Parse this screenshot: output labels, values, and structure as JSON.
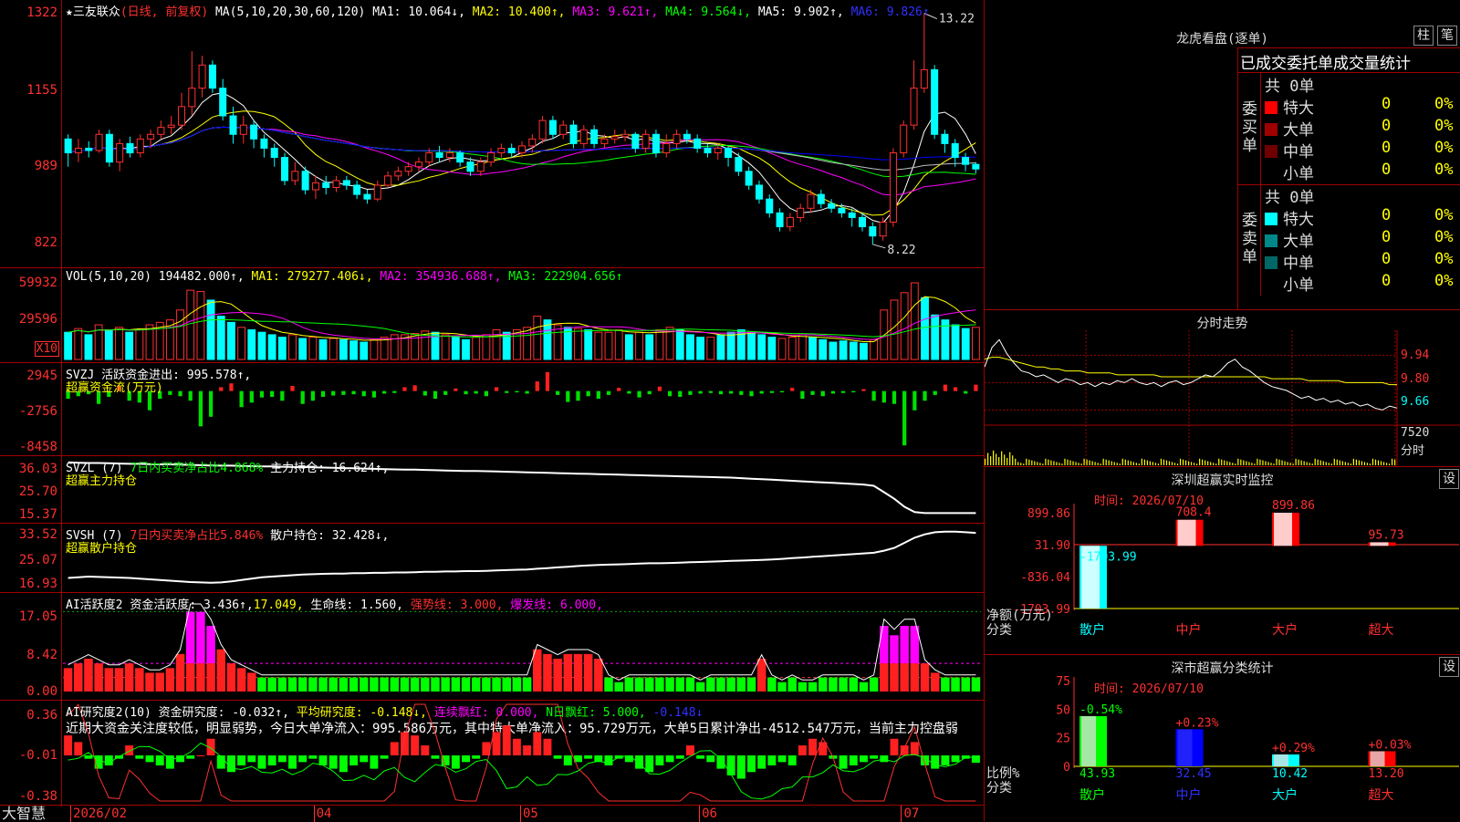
{
  "kline": {
    "ticks": [
      "1322",
      "1155",
      "989",
      "822"
    ],
    "legend": {
      "star": "★",
      "name": "三友联众",
      "mode": "(日线, 前复权)",
      "ma_def": "MA(5,10,20,30,60,120)",
      "ma1": "MA1: 10.064↓,",
      "ma2": "MA2: 10.400↑,",
      "ma3": "MA3: 9.621↑,",
      "ma4": "MA4: 9.564↓,",
      "ma5": "MA5: 9.902↑,",
      "ma6": "MA6: 9.826↑"
    },
    "hi_label": "13.22",
    "lo_label": "8.22",
    "candles": [
      [
        10.5,
        10.2,
        10.6,
        9.9
      ],
      [
        10.2,
        10.3,
        10.5,
        10.0
      ],
      [
        10.3,
        10.25,
        10.45,
        10.1
      ],
      [
        10.25,
        10.6,
        10.7,
        10.2
      ],
      [
        10.6,
        10.0,
        10.7,
        9.9
      ],
      [
        10.0,
        10.4,
        10.5,
        9.8
      ],
      [
        10.4,
        10.2,
        10.55,
        10.1
      ],
      [
        10.2,
        10.5,
        10.6,
        10.1
      ],
      [
        10.5,
        10.6,
        10.7,
        10.3
      ],
      [
        10.6,
        10.75,
        10.9,
        10.5
      ],
      [
        10.75,
        10.8,
        11.0,
        10.6
      ],
      [
        10.8,
        11.2,
        11.5,
        10.7
      ],
      [
        11.2,
        11.6,
        12.4,
        11.0
      ],
      [
        11.6,
        12.1,
        12.3,
        11.4
      ],
      [
        12.1,
        11.6,
        12.2,
        11.5
      ],
      [
        11.6,
        11.0,
        11.8,
        10.9
      ],
      [
        11.0,
        10.6,
        11.2,
        10.4
      ],
      [
        10.6,
        10.8,
        11.0,
        10.4
      ],
      [
        10.8,
        10.5,
        10.9,
        10.3
      ],
      [
        10.5,
        10.3,
        10.6,
        10.1
      ],
      [
        10.3,
        10.1,
        10.4,
        9.9
      ],
      [
        10.1,
        9.6,
        10.2,
        9.5
      ],
      [
        9.6,
        9.8,
        10.0,
        9.5
      ],
      [
        9.8,
        9.4,
        9.9,
        9.3
      ],
      [
        9.4,
        9.55,
        9.7,
        9.2
      ],
      [
        9.55,
        9.45,
        9.7,
        9.3
      ],
      [
        9.45,
        9.6,
        9.7,
        9.35
      ],
      [
        9.6,
        9.5,
        9.7,
        9.4
      ],
      [
        9.5,
        9.3,
        9.6,
        9.2
      ],
      [
        9.3,
        9.2,
        9.4,
        9.1
      ],
      [
        9.2,
        9.5,
        9.6,
        9.15
      ],
      [
        9.5,
        9.7,
        9.8,
        9.45
      ],
      [
        9.7,
        9.8,
        9.9,
        9.6
      ],
      [
        9.8,
        9.9,
        10.0,
        9.7
      ],
      [
        9.9,
        10.0,
        10.1,
        9.8
      ],
      [
        10.0,
        10.2,
        10.3,
        9.9
      ],
      [
        10.2,
        10.1,
        10.35,
        10.0
      ],
      [
        10.1,
        10.2,
        10.3,
        10.0
      ],
      [
        10.2,
        10.0,
        10.25,
        9.9
      ],
      [
        10.0,
        9.8,
        10.1,
        9.7
      ],
      [
        9.8,
        10.0,
        10.1,
        9.7
      ],
      [
        10.0,
        10.2,
        10.3,
        9.9
      ],
      [
        10.2,
        10.3,
        10.4,
        10.1
      ],
      [
        10.3,
        10.2,
        10.4,
        10.1
      ],
      [
        10.2,
        10.35,
        10.45,
        10.1
      ],
      [
        10.35,
        10.5,
        10.6,
        10.2
      ],
      [
        10.5,
        10.9,
        11.0,
        10.4
      ],
      [
        10.9,
        10.6,
        11.0,
        10.5
      ],
      [
        10.6,
        10.8,
        10.9,
        10.5
      ],
      [
        10.8,
        10.4,
        10.9,
        10.3
      ],
      [
        10.4,
        10.7,
        10.8,
        10.3
      ],
      [
        10.7,
        10.4,
        10.8,
        10.3
      ],
      [
        10.4,
        10.5,
        10.6,
        10.3
      ],
      [
        10.5,
        10.55,
        10.7,
        10.4
      ],
      [
        10.55,
        10.6,
        10.7,
        10.45
      ],
      [
        10.6,
        10.3,
        10.65,
        10.2
      ],
      [
        10.3,
        10.6,
        10.7,
        10.2
      ],
      [
        10.6,
        10.2,
        10.7,
        10.1
      ],
      [
        10.2,
        10.4,
        10.6,
        10.1
      ],
      [
        10.4,
        10.6,
        10.7,
        10.3
      ],
      [
        10.6,
        10.5,
        10.7,
        10.4
      ],
      [
        10.5,
        10.3,
        10.6,
        10.2
      ],
      [
        10.3,
        10.2,
        10.4,
        10.1
      ],
      [
        10.2,
        10.3,
        10.4,
        10.05
      ],
      [
        10.3,
        10.1,
        10.35,
        9.9
      ],
      [
        10.1,
        9.8,
        10.2,
        9.7
      ],
      [
        9.8,
        9.5,
        9.9,
        9.4
      ],
      [
        9.5,
        9.2,
        9.6,
        9.1
      ],
      [
        9.2,
        8.9,
        9.3,
        8.8
      ],
      [
        8.9,
        8.6,
        9.0,
        8.5
      ],
      [
        8.6,
        8.8,
        8.9,
        8.5
      ],
      [
        8.8,
        9.0,
        9.1,
        8.7
      ],
      [
        9.0,
        9.3,
        9.4,
        8.9
      ],
      [
        9.3,
        9.1,
        9.4,
        9.0
      ],
      [
        9.1,
        9.0,
        9.2,
        8.9
      ],
      [
        9.0,
        8.9,
        9.1,
        8.8
      ],
      [
        8.9,
        8.8,
        9.0,
        8.6
      ],
      [
        8.8,
        8.6,
        8.9,
        8.5
      ],
      [
        8.6,
        8.4,
        8.7,
        8.22
      ],
      [
        8.4,
        8.7,
        8.8,
        8.3
      ],
      [
        8.7,
        10.2,
        10.3,
        8.6
      ],
      [
        10.2,
        10.8,
        10.9,
        10.1
      ],
      [
        10.8,
        11.6,
        12.2,
        10.7
      ],
      [
        11.6,
        12.0,
        13.22,
        11.5
      ],
      [
        12.0,
        10.6,
        12.1,
        10.5
      ],
      [
        10.6,
        10.4,
        10.7,
        10.2
      ],
      [
        10.4,
        10.1,
        10.5,
        9.9
      ],
      [
        10.1,
        9.95,
        10.2,
        9.8
      ],
      [
        9.95,
        9.85,
        10.0,
        9.75
      ]
    ],
    "ma_colors": [
      "#ffffff",
      "#ffff00",
      "#ff00ff",
      "#00ff00",
      "#c0c0c0",
      "#0000ff"
    ]
  },
  "vol": {
    "ticks": [
      "59932",
      "29596"
    ],
    "unit": "X10",
    "legend": {
      "def": "VOL(5,10,20)",
      "val": "194482.000↑,",
      "ma1": "MA1: 279277.406↓,",
      "ma2": "MA2: 354936.688↑,",
      "ma3": "MA3: 222904.656↑"
    },
    "values": [
      22,
      25,
      20,
      28,
      24,
      26,
      22,
      24,
      28,
      30,
      32,
      40,
      56,
      55,
      48,
      35,
      30,
      26,
      24,
      22,
      20,
      18,
      20,
      17,
      18,
      16,
      17,
      16,
      15,
      14,
      16,
      18,
      20,
      20,
      21,
      23,
      22,
      20,
      18,
      16,
      18,
      20,
      24,
      22,
      24,
      26,
      35,
      32,
      28,
      26,
      25,
      24,
      22,
      22,
      24,
      20,
      22,
      20,
      24,
      26,
      24,
      20,
      18,
      18,
      20,
      22,
      24,
      22,
      20,
      18,
      17,
      18,
      20,
      18,
      16,
      14,
      15,
      14,
      13,
      16,
      40,
      48,
      54,
      62,
      50,
      36,
      32,
      28,
      25,
      26
    ]
  },
  "svzj": {
    "ticks": [
      "2945",
      "-2756",
      "-8458"
    ],
    "legend": {
      "def": "SVZJ",
      "label": "活跃资金进出:",
      "val": "995.578↑,"
    },
    "sub": "超赢资金流(万元)",
    "values": [
      -1200,
      -800,
      -500,
      -2000,
      -900,
      800,
      -1500,
      -1800,
      -3000,
      -1200,
      -600,
      -800,
      -1500,
      -5500,
      -4000,
      600,
      1200,
      -2500,
      -1800,
      -1000,
      -900,
      -1500,
      800,
      -2000,
      -1500,
      -900,
      -700,
      -600,
      -500,
      -800,
      -1000,
      -400,
      -300,
      600,
      900,
      -700,
      -1200,
      -600,
      400,
      -500,
      -400,
      -800,
      600,
      -300,
      -200,
      -400,
      1500,
      2945,
      -600,
      -1700,
      -1500,
      -800,
      -1200,
      -600,
      500,
      -400,
      -1000,
      -500,
      700,
      -800,
      -900,
      -600,
      -400,
      -300,
      -500,
      -400,
      -600,
      -800,
      -400,
      -300,
      -200,
      500,
      -1200,
      -600,
      -800,
      -400,
      -300,
      -200,
      300,
      -1500,
      -1800,
      -2000,
      -8458,
      -3000,
      -1500,
      -600,
      1000,
      600,
      -400,
      995
    ],
    "colors": {
      "pos": "#ff2020",
      "neg": "#00e000"
    }
  },
  "svzl": {
    "ticks": [
      "36.03",
      "25.70",
      "15.37"
    ],
    "legend": {
      "def": "SVZL (7)",
      "pct": "7日内买卖净占比4.868%",
      "label": "主力持仓:",
      "val": "16.624↑,"
    },
    "sub": "超赢主力持仓",
    "values": [
      35.8,
      35.6,
      35.5,
      35.5,
      35.4,
      35.3,
      35.2,
      35.2,
      35.1,
      35.0,
      35.0,
      34.9,
      34.8,
      34.7,
      34.6,
      34.5,
      34.5,
      34.4,
      34.3,
      34.2,
      34.2,
      34.1,
      34.0,
      34.0,
      33.9,
      33.8,
      33.7,
      33.6,
      33.5,
      33.4,
      33.3,
      33.2,
      33.1,
      33.0,
      33.0,
      32.9,
      32.8,
      32.7,
      32.6,
      32.5,
      32.5,
      32.4,
      32.3,
      32.2,
      32.1,
      32.0,
      31.9,
      31.8,
      31.7,
      31.6,
      31.5,
      31.4,
      31.3,
      31.2,
      31.1,
      31.0,
      30.9,
      30.8,
      30.7,
      30.6,
      30.5,
      30.4,
      30.3,
      30.2,
      30.1,
      30.0,
      29.8,
      29.6,
      29.4,
      29.2,
      29.0,
      28.8,
      28.6,
      28.4,
      28.2,
      28.0,
      27.8,
      27.6,
      27.4,
      26.9,
      24.5,
      22.0,
      19.0,
      17.0,
      16.6,
      16.6,
      16.6,
      16.6,
      16.6,
      16.624
    ]
  },
  "svsh": {
    "ticks": [
      "33.52",
      "25.07",
      "16.93"
    ],
    "legend": {
      "def": "SVSH (7)",
      "pct": "7日内买卖净占比5.846%",
      "label": "散户持仓:",
      "val": "32.428↓,"
    },
    "sub": "超赢散户持仓",
    "values": [
      19.2,
      19.4,
      19.6,
      19.5,
      19.4,
      19.3,
      19.2,
      19.0,
      18.8,
      18.6,
      18.4,
      18.2,
      18.0,
      17.9,
      17.8,
      17.9,
      18.2,
      18.6,
      19.0,
      19.4,
      19.6,
      19.8,
      20.0,
      20.2,
      20.3,
      20.4,
      20.5,
      20.5,
      20.6,
      20.6,
      20.7,
      20.7,
      20.8,
      20.8,
      20.9,
      21.0,
      21.0,
      21.1,
      21.1,
      21.2,
      21.2,
      21.3,
      21.4,
      21.5,
      21.6,
      21.7,
      21.9,
      22.1,
      22.3,
      22.5,
      22.7,
      22.9,
      23.0,
      23.1,
      23.2,
      23.3,
      23.4,
      23.5,
      23.5,
      23.6,
      23.7,
      23.8,
      23.9,
      24.0,
      24.1,
      24.2,
      24.3,
      24.4,
      24.5,
      24.6,
      24.8,
      25.0,
      25.2,
      25.4,
      25.6,
      25.8,
      26.0,
      26.2,
      26.4,
      26.6,
      27.2,
      28.0,
      29.5,
      31.0,
      32.0,
      32.6,
      32.8,
      32.8,
      32.6,
      32.428
    ]
  },
  "ai1": {
    "ticks": [
      "17.05",
      "8.42",
      "0.00"
    ],
    "legend": {
      "def": "AI活跃度2",
      "label": "资金活跃度:",
      "val": "3.436↑,",
      "v2": "17.049,",
      "life": "生命线: 1.560,",
      "strong": "强势线: 3.000,",
      "burst": "爆发线: 6.000,"
    },
    "values": [
      5,
      6,
      7,
      6,
      5,
      5,
      6,
      5,
      4,
      4,
      5,
      8,
      17,
      17,
      14,
      9,
      6,
      5,
      4,
      3,
      3,
      3,
      3,
      3,
      3,
      3,
      3,
      3,
      3,
      3,
      3,
      3,
      3,
      3,
      3,
      3,
      3,
      3,
      3,
      3,
      3,
      3,
      3,
      3,
      3,
      3,
      9,
      8,
      7,
      8,
      8,
      8,
      7,
      3,
      2,
      3,
      3,
      3,
      3,
      3,
      3,
      3,
      2,
      3,
      3,
      3,
      3,
      3,
      7,
      3,
      2,
      3,
      2,
      2,
      3,
      3,
      3,
      3,
      2,
      3,
      14,
      12,
      14,
      14,
      6,
      4,
      3,
      3,
      3,
      3
    ]
  },
  "ai2": {
    "ticks": [
      "0.36",
      "-0.01",
      "-0.38"
    ],
    "legend": {
      "def": "AI研究度2(10)",
      "label": "资金研究度:",
      "val": "-0.032↑,",
      "avg": "平均研究度: -0.148↓,",
      "red": "连续飘红: 0.000,",
      "nred": "N日飘红: 5.000,",
      "tail": "-0.148↓"
    },
    "sub": "近期大资金关注度较低，明显弱势，今日大单净流入：995.586万元，其中特大单净流入：95.729万元，大单5日累计净出-4512.547万元，当前主力控盘弱",
    "values": [
      0.05,
      0.03,
      -0.02,
      -0.05,
      -0.04,
      -0.02,
      0.02,
      -0.02,
      -0.03,
      -0.04,
      -0.05,
      -0.03,
      -0.02,
      -0.01,
      0.04,
      -0.05,
      -0.06,
      -0.04,
      -0.03,
      -0.05,
      -0.04,
      -0.03,
      -0.05,
      -0.03,
      -0.02,
      -0.04,
      -0.05,
      -0.06,
      -0.04,
      -0.03,
      -0.05,
      -0.02,
      0.03,
      0.06,
      0.05,
      0.02,
      -0.02,
      -0.04,
      -0.05,
      -0.03,
      -0.02,
      0.03,
      0.06,
      0.08,
      0.04,
      0.02,
      0.06,
      0.04,
      -0.02,
      -0.04,
      -0.03,
      -0.02,
      -0.03,
      -0.04,
      -0.02,
      -0.03,
      -0.05,
      -0.06,
      -0.04,
      -0.03,
      -0.02,
      0.02,
      -0.02,
      -0.03,
      -0.05,
      -0.07,
      -0.08,
      -0.06,
      -0.05,
      -0.04,
      -0.03,
      -0.04,
      0.02,
      0.04,
      0.03,
      -0.02,
      -0.05,
      -0.04,
      -0.03,
      -0.02,
      -0.03,
      0.04,
      0.02,
      0.03,
      -0.04,
      -0.05,
      -0.04,
      -0.03,
      -0.02,
      -0.032
    ]
  },
  "xaxis": {
    "brand": "大智慧",
    "labels": [
      {
        "t": "2026/02",
        "p": 0.005
      },
      {
        "t": "04",
        "p": 0.27
      },
      {
        "t": "05",
        "p": 0.495
      },
      {
        "t": "06",
        "p": 0.69
      },
      {
        "t": "07",
        "p": 0.91
      }
    ]
  },
  "longhu": {
    "title": "龙虎看盘(逐单)",
    "btn1": "柱",
    "btn2": "笔",
    "header": "已成交委托单成交量统计",
    "buy": {
      "side": "委买单",
      "total": "共 0单",
      "rows": [
        {
          "label": "特大",
          "color": "#ff0000",
          "count": "0",
          "pct": "0%"
        },
        {
          "label": "大单",
          "color": "#a00000",
          "count": "0",
          "pct": "0%"
        },
        {
          "label": "中单",
          "color": "#700000",
          "count": "0",
          "pct": "0%"
        },
        {
          "label": "小单",
          "color": "#000000",
          "count": "0",
          "pct": "0%"
        }
      ]
    },
    "sell": {
      "side": "委卖单",
      "total": "共 0单",
      "rows": [
        {
          "label": "特大",
          "color": "#00ffff",
          "count": "0",
          "pct": "0%"
        },
        {
          "label": "大单",
          "color": "#008888",
          "count": "0",
          "pct": "0%"
        },
        {
          "label": "中单",
          "color": "#006666",
          "count": "0",
          "pct": "0%"
        },
        {
          "label": "小单",
          "color": "#000000",
          "count": "0",
          "pct": "0%"
        }
      ]
    }
  },
  "fenshi": {
    "title": "分时走势",
    "ticks": [
      "9.94",
      "9.80",
      "9.66"
    ],
    "vol_tick": "7520",
    "vol_label": "分时",
    "price": [
      9.88,
      9.98,
      10.02,
      9.95,
      9.9,
      9.86,
      9.85,
      9.83,
      9.84,
      9.82,
      9.8,
      9.82,
      9.81,
      9.79,
      9.8,
      9.78,
      9.8,
      9.79,
      9.81,
      9.8,
      9.82,
      9.8,
      9.79,
      9.8,
      9.78,
      9.8,
      9.81,
      9.79,
      9.8,
      9.82,
      9.84,
      9.83,
      9.86,
      9.9,
      9.92,
      9.88,
      9.86,
      9.83,
      9.8,
      9.78,
      9.77,
      9.76,
      9.74,
      9.72,
      9.73,
      9.71,
      9.72,
      9.7,
      9.71,
      9.69,
      9.7,
      9.68,
      9.69,
      9.67,
      9.66,
      9.68,
      9.67
    ],
    "avg": [
      9.92,
      9.93,
      9.93,
      9.92,
      9.91,
      9.9,
      9.89,
      9.88,
      9.88,
      9.87,
      9.87,
      9.86,
      9.86,
      9.86,
      9.85,
      9.85,
      9.85,
      9.85,
      9.84,
      9.84,
      9.84,
      9.84,
      9.84,
      9.84,
      9.83,
      9.83,
      9.83,
      9.83,
      9.83,
      9.83,
      9.83,
      9.83,
      9.83,
      9.83,
      9.83,
      9.83,
      9.83,
      9.83,
      9.83,
      9.82,
      9.82,
      9.82,
      9.82,
      9.82,
      9.81,
      9.81,
      9.81,
      9.81,
      9.81,
      9.8,
      9.8,
      9.8,
      9.8,
      9.8,
      9.8,
      9.79,
      9.79
    ]
  },
  "szmon": {
    "title": "深圳超赢实时监控",
    "btn": "设",
    "time": "时间: 2026/07/10",
    "ticks": [
      "899.86",
      "31.90",
      "-836.04",
      "-1703.99"
    ],
    "ylabel1": "净额(万元)",
    "ylabel2": "分类",
    "bars": [
      {
        "cat": "散户",
        "val": -1703.99,
        "label": "-1703.99",
        "color": "#00ffff"
      },
      {
        "cat": "中户",
        "val": 708.4,
        "label": "708.4",
        "color": "#ff0000"
      },
      {
        "cat": "大户",
        "val": 899.86,
        "label": "899.86",
        "color": "#ff0000"
      },
      {
        "cat": "超大",
        "val": 95.73,
        "label": "95.73",
        "color": "#ff0000"
      }
    ]
  },
  "szcls": {
    "title": "深市超赢分类统计",
    "btn": "设",
    "time": "时间: 2026/07/10",
    "ticks": [
      "75",
      "50",
      "25",
      "0"
    ],
    "ylabel1": "比例%",
    "ylabel2": "分类",
    "bars": [
      {
        "cat": "散户",
        "val": 43.93,
        "label": "43.93",
        "chg": "-0.54%",
        "color": "#00ff00",
        "chgcolor": "#00ff00"
      },
      {
        "cat": "中户",
        "val": 32.45,
        "label": "32.45",
        "chg": "+0.23%",
        "color": "#0000ff",
        "chgcolor": "#ff3030"
      },
      {
        "cat": "大户",
        "val": 10.42,
        "label": "10.42",
        "chg": "+0.29%",
        "color": "#00ffff",
        "chgcolor": "#ff3030"
      },
      {
        "cat": "超大",
        "val": 13.2,
        "label": "13.20",
        "chg": "+0.03%",
        "color": "#ff0000",
        "chgcolor": "#ff3030"
      }
    ]
  }
}
